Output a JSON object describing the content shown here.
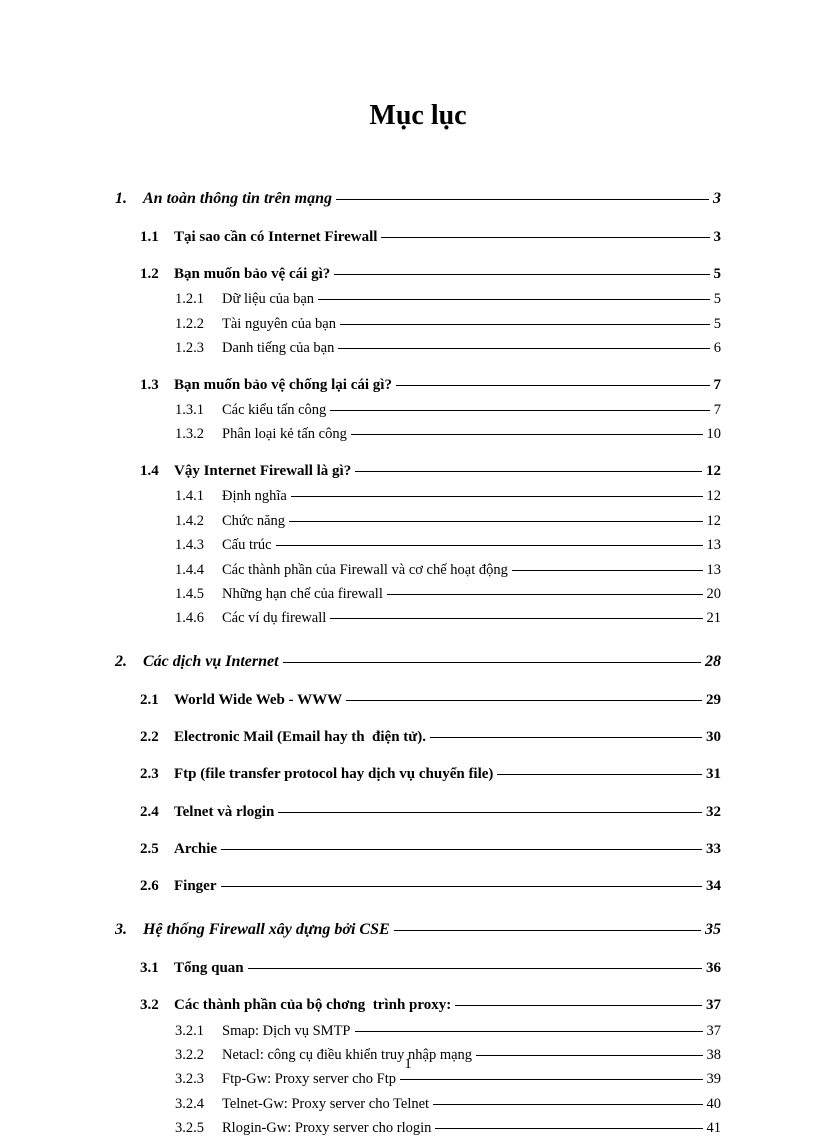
{
  "title": "Mục lục",
  "page_number": "1",
  "entries": [
    {
      "level": 1,
      "num": "1.",
      "label": "An toàn thông tin trên mạng",
      "page": "3"
    },
    {
      "level": 2,
      "num": "1.1",
      "label": "Tại sao cần có Internet Firewall",
      "page": "3"
    },
    {
      "level": 2,
      "num": "1.2",
      "label": "Bạn muốn bảo vệ cái gì?",
      "page": "5"
    },
    {
      "level": 3,
      "num": "1.2.1",
      "label": "Dữ liệu của bạn",
      "page": "5"
    },
    {
      "level": 3,
      "num": "1.2.2",
      "label": "Tài nguyên của bạn",
      "page": "5"
    },
    {
      "level": 3,
      "num": "1.2.3",
      "label": "Danh tiếng của bạn",
      "page": "6"
    },
    {
      "level": 2,
      "num": "1.3",
      "label": "Bạn muốn bảo vệ chống lại cái gì?",
      "page": "7"
    },
    {
      "level": 3,
      "num": "1.3.1",
      "label": "Các kiểu tấn công",
      "page": "7"
    },
    {
      "level": 3,
      "num": "1.3.2",
      "label": "Phân loại kẻ tấn công",
      "page": "10"
    },
    {
      "level": 2,
      "num": "1.4",
      "label": "Vậy Internet Firewall là gì?",
      "page": "12"
    },
    {
      "level": 3,
      "num": "1.4.1",
      "label": "Định nghĩa",
      "page": "12"
    },
    {
      "level": 3,
      "num": "1.4.2",
      "label": "Chức năng",
      "page": "12"
    },
    {
      "level": 3,
      "num": "1.4.3",
      "label": "Cấu trúc",
      "page": "13"
    },
    {
      "level": 3,
      "num": "1.4.4",
      "label": "Các thành phần của Firewall và cơ chế hoạt động",
      "page": "13"
    },
    {
      "level": 3,
      "num": "1.4.5",
      "label": "Những hạn chế của firewall",
      "page": "20"
    },
    {
      "level": 3,
      "num": "1.4.6",
      "label": "Các ví dụ firewall",
      "page": "21"
    },
    {
      "level": 1,
      "num": "2.",
      "label": "Các dịch vụ Internet",
      "page": "28"
    },
    {
      "level": 2,
      "num": "2.1",
      "label": "World Wide Web - WWW",
      "page": "29"
    },
    {
      "level": 2,
      "num": "2.2",
      "label": "Electronic Mail (Email hay th  điện tử).",
      "page": "30"
    },
    {
      "level": 2,
      "num": "2.3",
      "label": "Ftp (file transfer protocol hay dịch vụ chuyển file)",
      "page": "31"
    },
    {
      "level": 2,
      "num": "2.4",
      "label": "Telnet và rlogin",
      "page": "32"
    },
    {
      "level": 2,
      "num": "2.5",
      "label": "Archie",
      "page": "33"
    },
    {
      "level": 2,
      "num": "2.6",
      "label": "Finger",
      "page": "34"
    },
    {
      "level": 1,
      "num": "3.",
      "label": "Hệ thống Firewall xây dựng bởi CSE",
      "page": "35"
    },
    {
      "level": 2,
      "num": "3.1",
      "label": "Tổng quan",
      "page": "36"
    },
    {
      "level": 2,
      "num": "3.2",
      "label": "Các thành phần của bộ chơng  trình proxy:",
      "page": "37"
    },
    {
      "level": 3,
      "num": "3.2.1",
      "label": "Smap: Dịch vụ SMTP",
      "page": "37"
    },
    {
      "level": 3,
      "num": "3.2.2",
      "label": "Netacl: công cụ điều khiển truy nhập mạng",
      "page": "38"
    },
    {
      "level": 3,
      "num": "3.2.3",
      "label": "Ftp-Gw: Proxy server cho Ftp",
      "page": "39"
    },
    {
      "level": 3,
      "num": "3.2.4",
      "label": "Telnet-Gw: Proxy server cho Telnet",
      "page": "40"
    },
    {
      "level": 3,
      "num": "3.2.5",
      "label": "Rlogin-Gw: Proxy server cho rlogin",
      "page": "41"
    }
  ]
}
